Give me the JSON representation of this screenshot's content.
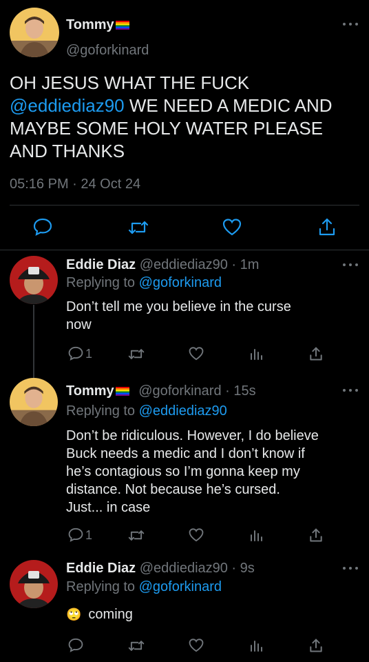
{
  "main_tweet": {
    "display_name": "Tommy",
    "handle": "@goforkinard",
    "text_line1": "OH JESUS WHAT THE FUCK",
    "mention": "@eddiediaz90",
    "text_line2_rest": " WE NEED A MEDIC AND",
    "text_line3": "MAYBE SOME HOLY WATER PLEASE",
    "text_line4": "AND THANKS",
    "time": "05:16 PM · 24 Oct 24"
  },
  "replies": [
    {
      "display_name": "Eddie Diaz",
      "handle_time": "@eddiediaz90 · 1m",
      "replying_prefix": "Replying to ",
      "replying_to": "@goforkinard",
      "text_lines": [
        "Don’t tell me you believe in the curse",
        "now"
      ],
      "reply_count": "1"
    },
    {
      "display_name": "Tommy",
      "handle_time": "@goforkinard · 15s",
      "replying_prefix": "Replying to ",
      "replying_to": "@eddiediaz90",
      "text_lines": [
        "Don’t be ridiculous. However, I do believe",
        "Buck needs a medic and I don’t know if",
        "he’s contagious so I’m gonna keep my",
        "distance. Not because he’s cursed.",
        "Just... in case"
      ],
      "reply_count": "1"
    },
    {
      "display_name": "Eddie Diaz",
      "handle_time": "@eddiediaz90 · 9s",
      "replying_prefix": "Replying to ",
      "replying_to": "@goforkinard",
      "emoji": "🙄",
      "text": "coming"
    }
  ],
  "icons": {
    "reply": "speech-bubble-icon",
    "retweet": "retweet-icon",
    "like": "heart-icon",
    "analytics": "analytics-icon",
    "share": "share-icon",
    "more": "more-icon"
  },
  "colors": {
    "accent": "#1d9bf0",
    "muted": "#71767b",
    "background": "#000000"
  }
}
